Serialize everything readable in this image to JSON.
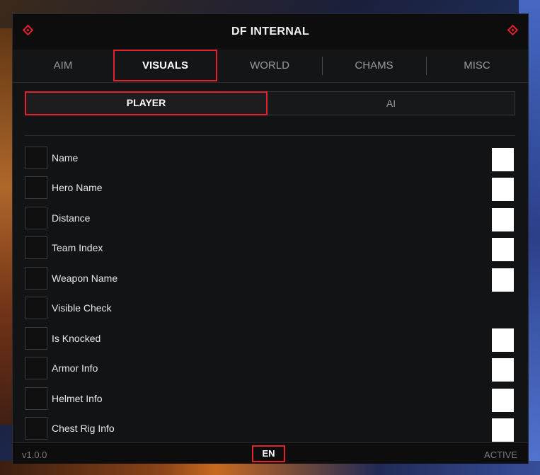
{
  "window": {
    "title": "DF INTERNAL"
  },
  "tabs": [
    {
      "label": "AIM"
    },
    {
      "label": "VISUALS"
    },
    {
      "label": "WORLD"
    },
    {
      "label": "CHAMS"
    },
    {
      "label": "MISC"
    }
  ],
  "subtabs": [
    {
      "label": "PLAYER"
    },
    {
      "label": "AI"
    }
  ],
  "options": [
    {
      "label": "Name"
    },
    {
      "label": "Hero Name"
    },
    {
      "label": "Distance"
    },
    {
      "label": "Team Index"
    },
    {
      "label": "Weapon Name"
    },
    {
      "label": "Visible Check"
    },
    {
      "label": "Is Knocked"
    },
    {
      "label": "Armor Info"
    },
    {
      "label": "Helmet Info"
    },
    {
      "label": "Chest Rig Info"
    }
  ],
  "footer": {
    "version": "v1.0.0",
    "language": "EN",
    "status": "ACTIVE"
  },
  "colors": {
    "accent": "#e3222b",
    "background": "#121314",
    "swatch": "#ffffff"
  },
  "icons": {
    "title_left": "diamond-icon",
    "title_right": "diamond-icon"
  }
}
